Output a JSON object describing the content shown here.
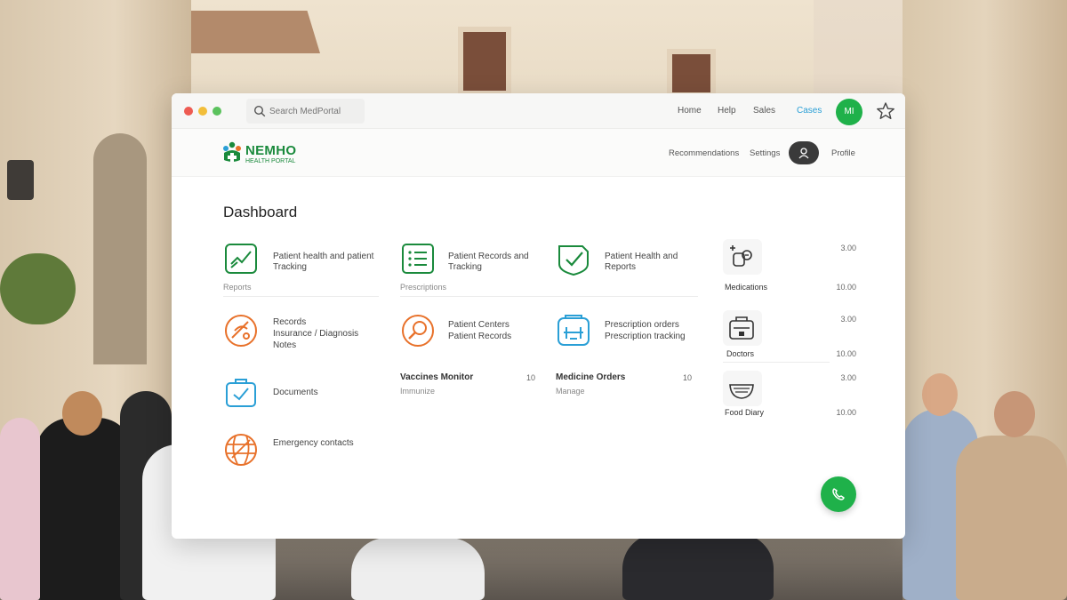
{
  "titlebar": {
    "search_placeholder": "Search MedPortal",
    "links": [
      "Home",
      "Help",
      "Sales",
      "Cases"
    ],
    "avatar": "MI"
  },
  "header": {
    "logo_title": "NEMHO",
    "logo_subtitle": "HEALTH PORTAL",
    "links": [
      "Recommendations",
      "Settings",
      "Profile"
    ]
  },
  "main": {
    "title": "Dashboard",
    "items": [
      {
        "line1": "Patient health and patient",
        "line2": "Tracking",
        "sub": "Reports"
      },
      {
        "line1": "Patient Records and",
        "line2": "Tracking",
        "sub": "Prescriptions"
      },
      {
        "line1": "Patient Health and",
        "line2": "Reports",
        "sub": ""
      },
      {
        "line1": "Records",
        "line2": "Insurance / Diagnosis",
        "line3": "Notes"
      },
      {
        "line1": "Patient Centers",
        "line2": "Patient Records",
        "sub": ""
      },
      {
        "line1": "Prescription orders",
        "line2": "Prescription tracking",
        "sub": ""
      },
      {
        "line1": "Documents",
        "sub": ""
      },
      {
        "line1": "Vaccines Monitor",
        "sub": "Immunize",
        "count": "10"
      },
      {
        "line1": "Medicine Orders",
        "sub": "Manage",
        "count": "10"
      },
      {
        "line1": "Emergency contacts",
        "sub": ""
      }
    ],
    "side": [
      {
        "label": "Medications",
        "n1": "3.00",
        "n2": "10.00"
      },
      {
        "label": "Doctors",
        "n1": "3.00",
        "n2": "10.00"
      },
      {
        "label": "Food Diary",
        "n1": "3.00",
        "n2": "10.00"
      }
    ]
  },
  "colors": {
    "brand_green": "#1a8a3c",
    "accent_blue": "#2a9fd6",
    "accent_orange": "#e8712a",
    "fab_green": "#1fb14a"
  },
  "icons": {
    "search": "search-icon",
    "star": "star-icon",
    "fab": "phone-icon"
  }
}
